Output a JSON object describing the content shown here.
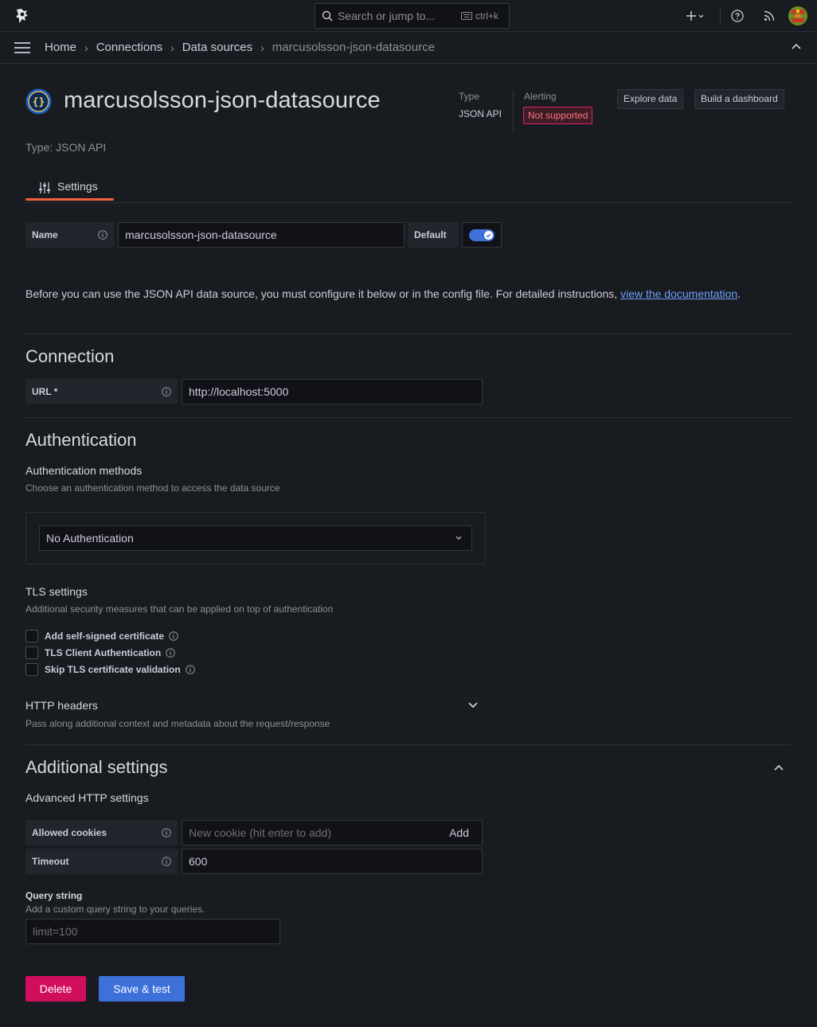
{
  "topbar": {
    "search_placeholder": "Search or jump to...",
    "search_shortcut": "ctrl+k",
    "icons": [
      "grafana-logo-icon",
      "search-icon",
      "keyboard-icon",
      "plus-icon",
      "help-icon",
      "rss-icon",
      "avatar"
    ]
  },
  "breadcrumb": {
    "items": [
      "Home",
      "Connections",
      "Data sources",
      "marcusolsson-json-datasource"
    ]
  },
  "header": {
    "title": "marcusolsson-json-datasource",
    "type_label": "Type",
    "type_value": "JSON API",
    "alerting_label": "Alerting",
    "alerting_badge": "Not supported",
    "explore_button": "Explore data",
    "dashboard_button": "Build a dashboard",
    "subtitle": "Type: JSON API"
  },
  "tabs": [
    {
      "label": "Settings",
      "active": true
    }
  ],
  "name_field": {
    "label": "Name",
    "value": "marcusolsson-json-datasource",
    "default_label": "Default",
    "default_on": true
  },
  "intro": {
    "text": "Before you can use the JSON API data source, you must configure it below or in the config file. For detailed instructions, ",
    "link": "view the documentation",
    "end": "."
  },
  "connection": {
    "heading": "Connection",
    "url_label": "URL *",
    "url_value": "http://localhost:5000"
  },
  "authentication": {
    "heading": "Authentication",
    "methods_title": "Authentication methods",
    "methods_desc": "Choose an authentication method to access the data source",
    "method_selected": "No Authentication",
    "tls_title": "TLS settings",
    "tls_desc": "Additional security measures that can be applied on top of authentication",
    "tls_options": [
      "Add self-signed certificate",
      "TLS Client Authentication",
      "Skip TLS certificate validation"
    ],
    "headers_title": "HTTP headers",
    "headers_desc": "Pass along additional context and metadata about the request/response"
  },
  "additional": {
    "heading": "Additional settings",
    "advanced_title": "Advanced HTTP settings",
    "cookies_label": "Allowed cookies",
    "cookies_placeholder": "New cookie (hit enter to add)",
    "cookies_add": "Add",
    "timeout_label": "Timeout",
    "timeout_value": "600",
    "query_title": "Query string",
    "query_desc": "Add a custom query string to your queries.",
    "query_placeholder": "limit=100"
  },
  "actions": {
    "delete": "Delete",
    "save": "Save & test"
  },
  "colors": {
    "background": "#181b1f",
    "primary": "#3d71d9",
    "danger": "#d10e5c",
    "tab_accent": "#f55f3e"
  }
}
